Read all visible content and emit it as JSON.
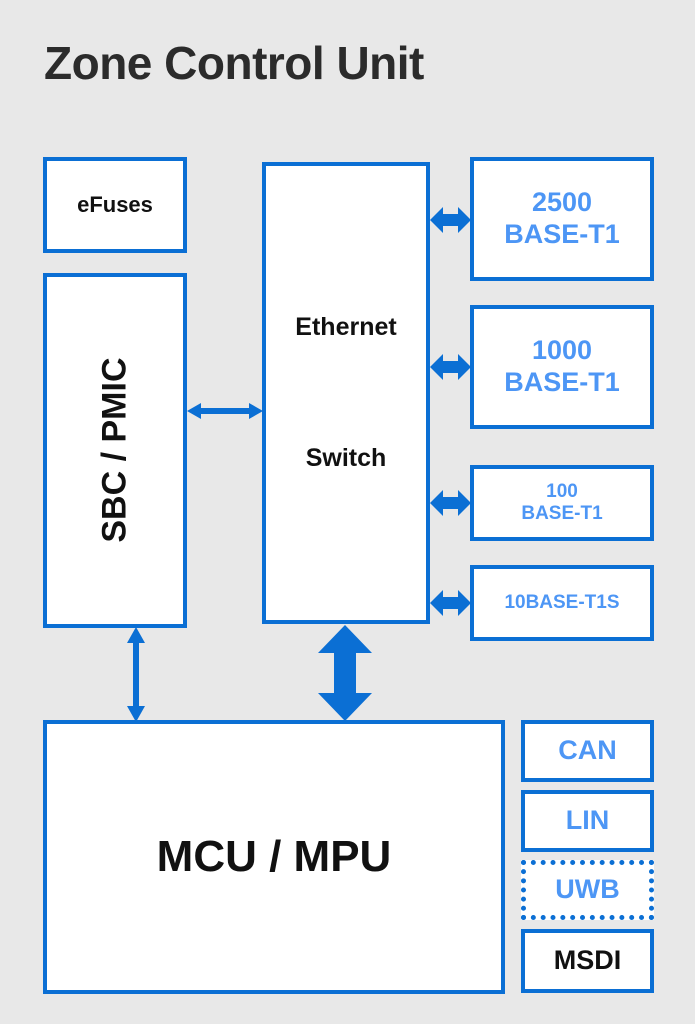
{
  "diagram": {
    "title": "Zone Control Unit",
    "background_color": "#e8e8e8",
    "accent_color": "#0b6fd4",
    "light_accent_color": "#4d96f5",
    "text_color": "#111111"
  },
  "blocks": {
    "efuses": {
      "label": "eFuses",
      "style": "solid",
      "text_color": "dark"
    },
    "sbc_pmic": {
      "label": "SBC / PMIC",
      "style": "solid",
      "text_color": "dark",
      "orientation": "vertical"
    },
    "ethernet_switch": {
      "line1": "Ethernet",
      "line2": "Switch",
      "style": "solid",
      "text_color": "dark"
    },
    "phy_2500": {
      "line1": "2500",
      "line2": "BASE-T1",
      "style": "solid",
      "text_color": "accent"
    },
    "phy_1000": {
      "line1": "1000",
      "line2": "BASE-T1",
      "style": "solid",
      "text_color": "accent"
    },
    "phy_100": {
      "line1": "100",
      "line2": "BASE-T1",
      "style": "solid",
      "text_color": "accent"
    },
    "phy_10": {
      "label": "10BASE-T1S",
      "style": "solid",
      "text_color": "accent"
    },
    "mcu_mpu": {
      "label": "MCU / MPU",
      "style": "solid",
      "text_color": "dark"
    },
    "can": {
      "label": "CAN",
      "style": "solid",
      "text_color": "accent"
    },
    "lin": {
      "label": "LIN",
      "style": "solid",
      "text_color": "accent"
    },
    "uwb": {
      "label": "UWB",
      "style": "dotted",
      "text_color": "accent"
    },
    "msdi": {
      "label": "MSDI",
      "style": "solid",
      "text_color": "dark"
    }
  },
  "connections": [
    {
      "name": "sbc-to-ethernet",
      "from": "sbc_pmic",
      "to": "ethernet_switch",
      "direction": "bidirectional",
      "orientation": "horizontal",
      "weight": "thin"
    },
    {
      "name": "ethernet-to-phy-2500",
      "from": "ethernet_switch",
      "to": "phy_2500",
      "direction": "bidirectional",
      "orientation": "horizontal",
      "weight": "thick"
    },
    {
      "name": "ethernet-to-phy-1000",
      "from": "ethernet_switch",
      "to": "phy_1000",
      "direction": "bidirectional",
      "orientation": "horizontal",
      "weight": "thick"
    },
    {
      "name": "ethernet-to-phy-100",
      "from": "ethernet_switch",
      "to": "phy_100",
      "direction": "bidirectional",
      "orientation": "horizontal",
      "weight": "thick"
    },
    {
      "name": "ethernet-to-phy-10",
      "from": "ethernet_switch",
      "to": "phy_10",
      "direction": "bidirectional",
      "orientation": "horizontal",
      "weight": "thick"
    },
    {
      "name": "sbc-to-mcu",
      "from": "sbc_pmic",
      "to": "mcu_mpu",
      "direction": "bidirectional",
      "orientation": "vertical",
      "weight": "thin"
    },
    {
      "name": "ethernet-to-mcu",
      "from": "ethernet_switch",
      "to": "mcu_mpu",
      "direction": "bidirectional",
      "orientation": "vertical",
      "weight": "thick"
    }
  ]
}
